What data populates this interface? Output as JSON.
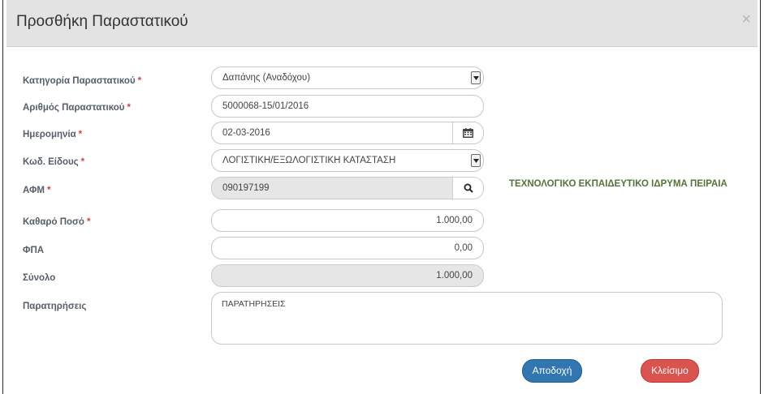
{
  "dialog": {
    "title": "Προσθήκη Παραστατικού",
    "close_symbol": "×"
  },
  "required_marker": "*",
  "form": {
    "category": {
      "label": "Κατηγορία Παραστατικού",
      "value": "Δαπάνης (Αναδόχου)"
    },
    "doc_number": {
      "label": "Αριθμός Παραστατικού",
      "value": "5000068-15/01/2016"
    },
    "date": {
      "label": "Ημερομηνία",
      "value": "02-03-2016"
    },
    "item_code": {
      "label": "Κωδ. Είδους",
      "value": "ΛΟΓΙΣΤΙΚΗ/ΕΞΩΛΟΓΙΣΤΙΚΗ ΚΑΤΑΣΤΑΣΗ"
    },
    "afm": {
      "label": "ΑΦΜ",
      "value": "090197199",
      "org_name": "ΤΕΧΝΟΛΟΓΙΚΟ ΕΚΠΑΙΔΕΥΤΙΚΟ ΙΔΡΥΜΑ ΠΕΙΡΑΙΑ"
    },
    "net_amount": {
      "label": "Καθαρό Ποσό",
      "value": "1.000,00"
    },
    "vat": {
      "label": "ΦΠΑ",
      "value": "0,00"
    },
    "total": {
      "label": "Σύνολο",
      "value": "1.000,00"
    },
    "notes": {
      "label": "Παρατηρήσεις",
      "value": "ΠΑΡΑΤΗΡΗΣΕΙΣ"
    }
  },
  "buttons": {
    "accept": "Αποδοχή",
    "close": "Κλείσιμο"
  },
  "icons": {
    "calendar": "calendar-icon",
    "search": "search-icon",
    "dropdown": "dropdown-arrow-icon"
  },
  "colors": {
    "required": "#e03b3b",
    "accept_button": "#3276b1",
    "close_button": "#d9534f",
    "org_name": "#52743a"
  }
}
